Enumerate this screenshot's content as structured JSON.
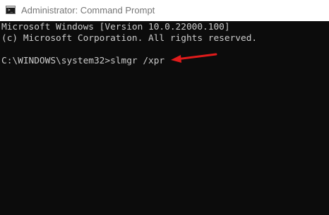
{
  "window": {
    "title": "Administrator: Command Prompt",
    "icon": "cmd-icon"
  },
  "console": {
    "lines": [
      "Microsoft Windows [Version 10.0.22000.100]",
      "(c) Microsoft Corporation. All rights reserved.",
      "",
      "C:\\WINDOWS\\system32>slmgr /xpr"
    ],
    "text_color": "#cccccc",
    "background_color": "#0c0c0c"
  },
  "annotation": {
    "icon": "red-arrow-icon",
    "color": "#e01b1b"
  }
}
